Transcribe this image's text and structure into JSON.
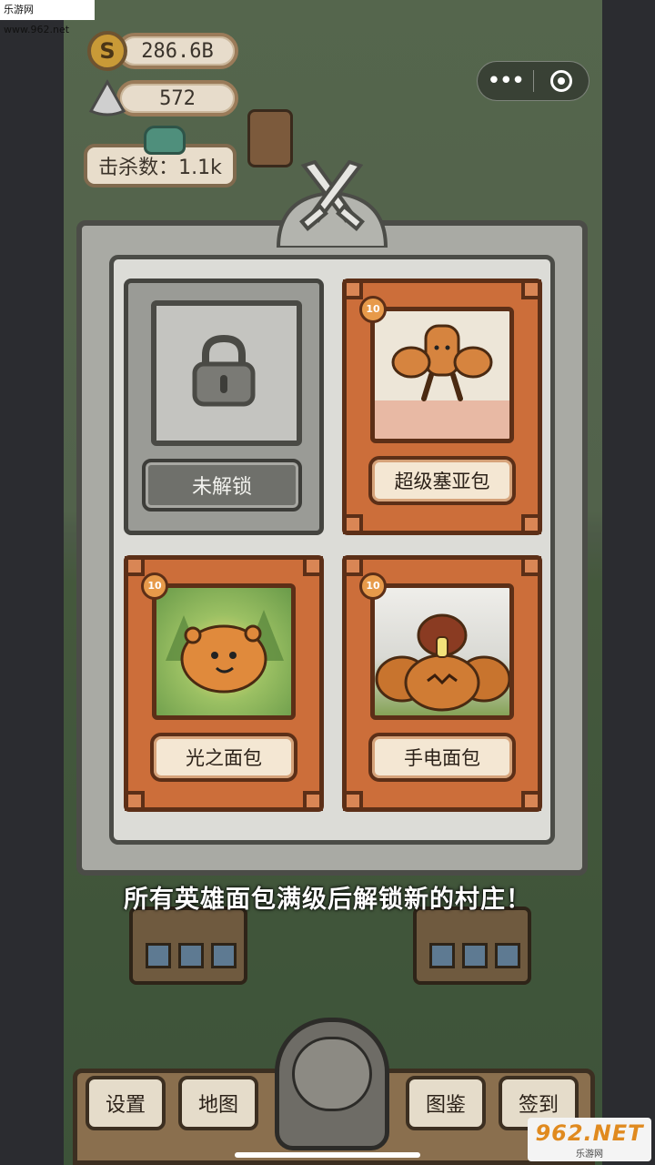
{
  "watermark": {
    "top_text": "乐游网 www.962.net",
    "bottom_big": "962.NET",
    "bottom_small": "乐游网"
  },
  "hud": {
    "coins": "286.6B",
    "gems": "572",
    "kills_label": "击杀数：1.1k"
  },
  "mini_program": {
    "more_icon": "more-dots-icon",
    "close_icon": "target-ring-icon"
  },
  "collection": {
    "locked_card": {
      "label": "未解锁",
      "icon": "padlock-icon"
    },
    "cards": [
      {
        "name": "超级塞亚包",
        "level": "10"
      },
      {
        "name": "光之面包",
        "level": "10"
      },
      {
        "name": "手电面包",
        "level": "10"
      }
    ]
  },
  "caption": "所有英雄面包满级后解锁新的村庄！",
  "bottom_nav": {
    "settings": "设置",
    "map": "地图",
    "codex": "图鉴",
    "checkin": "签到"
  },
  "colors": {
    "card_orange": "#cc6e3a",
    "locked_gray": "#9a9b96",
    "frame_dark": "#4b4c47"
  }
}
